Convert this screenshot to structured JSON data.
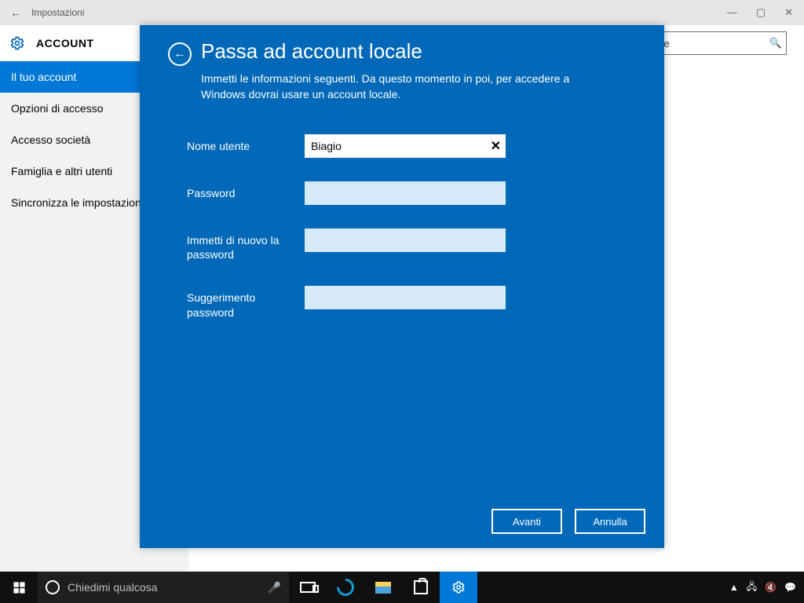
{
  "window": {
    "title": "Impostazioni",
    "header_label": "ACCOUNT",
    "search_placeholder": "one",
    "controls": {
      "min": "—",
      "max": "▢",
      "close": "✕"
    }
  },
  "sidebar": {
    "items": [
      {
        "label": "Il tuo account",
        "active": true
      },
      {
        "label": "Opzioni di accesso",
        "active": false
      },
      {
        "label": "Accesso società",
        "active": false
      },
      {
        "label": "Famiglia e altri utenti",
        "active": false
      },
      {
        "label": "Sincronizza le impostazioni",
        "active": false
      }
    ]
  },
  "dialog": {
    "title": "Passa ad account locale",
    "subtitle": "Immetti le informazioni seguenti. Da questo momento in poi, per accedere a Windows dovrai usare un account locale.",
    "fields": {
      "username_label": "Nome utente",
      "username_value": "Biagio",
      "password_label": "Password",
      "password2_label": "Immetti di nuovo la password",
      "hint_label": "Suggerimento password"
    },
    "buttons": {
      "next": "Avanti",
      "cancel": "Annulla"
    }
  },
  "taskbar": {
    "search_placeholder": "Chiedimi qualcosa"
  }
}
